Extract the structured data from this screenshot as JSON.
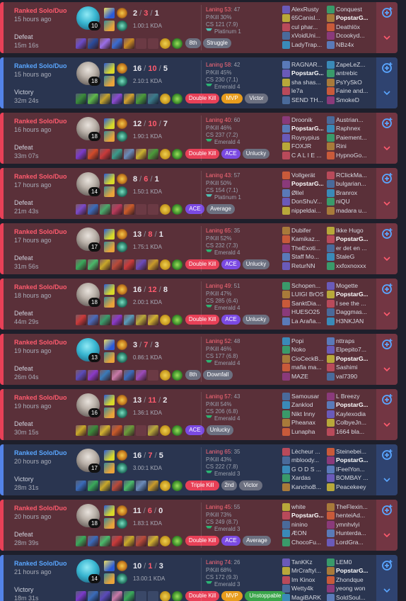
{
  "tags": {
    "double_kill": {
      "label": "Double Kill",
      "color": "#e84057"
    },
    "triple_kill": {
      "label": "Triple Kill",
      "color": "#e84057"
    },
    "mvp": {
      "label": "MVP",
      "color": "#e89d1e"
    },
    "ace": {
      "label": "ACE",
      "color": "#7b4ae2"
    },
    "unstoppable": {
      "label": "Unstoppable",
      "color": "#3aa54a"
    },
    "struggle": {
      "label": "Struggle",
      "color": "#6c7080"
    },
    "victor": {
      "label": "Victor",
      "color": "#6c7080"
    },
    "unlucky": {
      "label": "Unlucky",
      "color": "#6c7080"
    },
    "average": {
      "label": "Average",
      "color": "#6c7080"
    },
    "downfall": {
      "label": "Downfall",
      "color": "#6c7080"
    },
    "place_8th": {
      "label": "8th",
      "color": "#6c7080"
    },
    "place_2nd": {
      "label": "2nd",
      "color": "#6c7080"
    }
  },
  "matches": [
    {
      "result": "Defeat",
      "queue": "Ranked Solo/Duo",
      "ago": "15 hours ago",
      "duration": "15m 16s",
      "champ": "gwen",
      "level": "10",
      "kills": "2",
      "deaths": "3",
      "assists": "1",
      "kda": "1.00:1 KDA",
      "laning_label": "Laning 53",
      "laning_opp": ": 47",
      "pkill": "P/Kill 30%",
      "cs": "CS 121 (7.9)",
      "rank": "Platinum 1",
      "rank_color": "#4ec2b5",
      "items": [
        "#6b4bc8",
        "#2a4a9a",
        "#9a6ee8",
        "#3a6bd0",
        "#c98a24",
        "empty",
        "empty",
        "ward"
      ],
      "tags": [
        "place_8th",
        "struggle"
      ],
      "team1": [
        "AlexRusty",
        "65Canisl...",
        "cul phar...",
        "xVoidUni...",
        "LadyTrap..."
      ],
      "team2": [
        "Conquest",
        "PopstarG...",
        "Deathlöx",
        "Dcookyd...",
        "NBz4x"
      ],
      "me_team": 2,
      "me_idx": 1
    },
    {
      "result": "Victory",
      "queue": "Ranked Solo/Duo",
      "ago": "15 hours ago",
      "duration": "32m 24s",
      "champ": "man",
      "level": "18",
      "kills": "16",
      "deaths": "10",
      "assists": "5",
      "kda": "2.10:1 KDA",
      "laning_label": "Laning 58",
      "laning_opp": ": 42",
      "pkill": "P/Kill 45%",
      "cs": "CS 230 (7.1)",
      "rank": "Emerald 4",
      "rank_color": "#2bb673",
      "items": [
        "#3a8a3a",
        "#5fb84a",
        "#c4a22e",
        "#8a4ad0",
        "#d0a030",
        "#4a9a3a",
        "#3a7a8a",
        "ward"
      ],
      "tags": [
        "double_kill",
        "mvp",
        "victor"
      ],
      "team1": [
        "RAGNAR...",
        "PopstarG...",
        "sha shas...",
        "le7a",
        "SEND TH..."
      ],
      "team2": [
        "ZapeLeZ...",
        "antrebic",
        "PsYySkO",
        "Faine and...",
        "SmokeD"
      ],
      "me_team": 1,
      "me_idx": 1
    },
    {
      "result": "Defeat",
      "queue": "Ranked Solo/Duo",
      "ago": "16 hours ago",
      "duration": "33m 07s",
      "champ": "man",
      "level": "18",
      "kills": "12",
      "deaths": "10",
      "assists": "7",
      "kda": "1.90:1 KDA",
      "laning_label": "Laning 40",
      "laning_opp": ": 60",
      "pkill": "P/Kill 46%",
      "cs": "CS 237 (7.2)",
      "rank": "Emerald 4",
      "rank_color": "#2bb673",
      "items": [
        "#7a3ac8",
        "#d04a2a",
        "#c83a3a",
        "#3a9a8a",
        "#6a8ab8",
        "#c8b030",
        "#4a9a3a",
        "ward"
      ],
      "tags": [
        "double_kill",
        "ace",
        "unlucky"
      ],
      "team1": [
        "Droonik",
        "PopstarG...",
        "Roysypius",
        "FOXJR",
        "C A L I E ..."
      ],
      "team2": [
        "Austrian...",
        "Raphnex",
        "Paiement...",
        "Rini",
        "HypnoGo..."
      ],
      "me_team": 1,
      "me_idx": 1
    },
    {
      "result": "Defeat",
      "queue": "Ranked Solo/Duo",
      "ago": "17 hours ago",
      "duration": "21m 43s",
      "champ": "man",
      "level": "14",
      "kills": "8",
      "deaths": "6",
      "assists": "1",
      "kda": "1.50:1 KDA",
      "laning_label": "Laning 43",
      "laning_opp": ": 57",
      "pkill": "P/Kill 50%",
      "cs": "CS 154 (7.1)",
      "rank": "Platinum 1",
      "rank_color": "#4ec2b5",
      "items": [
        "#7a4ac8",
        "#3a6ab8",
        "#4aa86a",
        "#b83a5a",
        "#c85a2a",
        "empty",
        "empty",
        "ward"
      ],
      "tags": [
        "ace",
        "average"
      ],
      "team1": [
        "Vollgerät",
        "PopstarG...",
        "Øllel",
        "DonShuV...",
        "nippeldai..."
      ],
      "team2": [
        "RClickMa...",
        "bulgarian...",
        "Branrox",
        "niQU",
        "madara u..."
      ],
      "me_team": 1,
      "me_idx": 1
    },
    {
      "result": "Defeat",
      "queue": "Ranked Solo/Duo",
      "ago": "17 hours ago",
      "duration": "31m 56s",
      "champ": "man",
      "level": "17",
      "kills": "13",
      "deaths": "8",
      "assists": "1",
      "kda": "1.75:1 KDA",
      "laning_label": "Laning 65",
      "laning_opp": ": 35",
      "pkill": "P/Kill 52%",
      "cs": "CS 232 (7.3)",
      "rank": "Emerald 4",
      "rank_color": "#2bb673",
      "items": [
        "#3aa85a",
        "#4ab86a",
        "#c8a82a",
        "#b84a3a",
        "#c83a3a",
        "#6a4ab8",
        "#c89a2a",
        "ward"
      ],
      "tags": [
        "double_kill",
        "ace",
        "unlucky"
      ],
      "team1": [
        "Dubifer",
        "Kamikaz...",
        "TheExoti...",
        "Staff Mo...",
        "ReturNN"
      ],
      "team2": [
        "Ikke Hugo",
        "PopstarG...",
        "er det en ...",
        "StaleG",
        "xxfoxnoxxx"
      ],
      "me_team": 2,
      "me_idx": 1
    },
    {
      "result": "Defeat",
      "queue": "Ranked Solo/Duo",
      "ago": "18 hours ago",
      "duration": "44m 29s",
      "champ": "man",
      "level": "18",
      "kills": "16",
      "deaths": "12",
      "assists": "8",
      "kda": "2.00:1 KDA",
      "laning_label": "Laning 49",
      "laning_opp": ": 51",
      "pkill": "P/Kill 47%",
      "cs": "CS 285 (6.4)",
      "rank": "Emerald 4",
      "rank_color": "#2bb673",
      "items": [
        "#c83a3a",
        "#4a6ab8",
        "#3a9a6a",
        "#8a3ac8",
        "#5a9ab8",
        "#b8a83a",
        "#d0b030",
        "ward"
      ],
      "tags": [
        "double_kill",
        "ace",
        "unlucky"
      ],
      "team1": [
        "Schopen...",
        "LUIGI BrOS",
        "SanktDia...",
        "HUESO25",
        "La Araña..."
      ],
      "team2": [
        "Mogette",
        "PopstarG...",
        "I see the ...",
        "Daggmas...",
        "H3NKJAN"
      ],
      "me_team": 2,
      "me_idx": 1
    },
    {
      "result": "Defeat",
      "queue": "Ranked Solo/Duo",
      "ago": "19 hours ago",
      "duration": "26m 04s",
      "champ": "gwen",
      "level": "13",
      "kills": "3",
      "deaths": "7",
      "assists": "3",
      "kda": "0.86:1 KDA",
      "laning_label": "Laning 52",
      "laning_opp": ": 48",
      "pkill": "P/Kill 46%",
      "cs": "CS 177 (6.8)",
      "rank": "Emerald 4",
      "rank_color": "#2bb673",
      "items": [
        "#5a4ab8",
        "#8a3ac8",
        "#3a7ab8",
        "#c87aa8",
        "#3a6ab8",
        "#9a4ab8",
        "empty",
        "ward"
      ],
      "tags": [
        "place_8th",
        "downfall"
      ],
      "team1": [
        "Popi",
        "Noko",
        "CioCeckB...",
        "mafia ma...",
        "MAZE"
      ],
      "team2": [
        "nttraps",
        "Elpepito7...",
        "PopstarG...",
        "Sashimi",
        "val7390"
      ],
      "me_team": 2,
      "me_idx": 2
    },
    {
      "result": "Defeat",
      "queue": "Ranked Solo/Duo",
      "ago": "19 hours ago",
      "duration": "30m 15s",
      "champ": "man",
      "level": "16",
      "kills": "13",
      "deaths": "11",
      "assists": "2",
      "kda": "1.36:1 KDA",
      "laning_label": "Laning 57",
      "laning_opp": ": 43",
      "pkill": "P/Kill 54%",
      "cs": "CS 206 (6.8)",
      "rank": "Emerald 4",
      "rank_color": "#2bb673",
      "items": [
        "#c8a82a",
        "#3a8a3a",
        "#d0b030",
        "#c85a2a",
        "#6a9a3a",
        "empty",
        "#b8a83a",
        "ward"
      ],
      "tags": [
        "ace",
        "unlucky"
      ],
      "team1": [
        "Samousar",
        "Zanklod",
        "Nikt Inny",
        "Pheanax",
        "Lunapha"
      ],
      "team2": [
        "L Breezy",
        "PopstarG...",
        "Kaylexodia",
        "ColbyeJn...",
        "1664 bla..."
      ],
      "me_team": 2,
      "me_idx": 1
    },
    {
      "result": "Victory",
      "queue": "Ranked Solo/Duo",
      "ago": "20 hours ago",
      "duration": "28m 31s",
      "champ": "man",
      "level": "17",
      "kills": "16",
      "deaths": "7",
      "assists": "5",
      "kda": "3.00:1 KDA",
      "laning_label": "Laning 65",
      "laning_opp": ": 35",
      "pkill": "P/Kill 43%",
      "cs": "CS 222 (7.8)",
      "rank": "Emerald 3",
      "rank_color": "#2bb673",
      "items": [
        "#3a6ab8",
        "#3aa85a",
        "#c8a82a",
        "#b84a3a",
        "#4ab86a",
        "#6a8ab8",
        "#c89a2a",
        "ward"
      ],
      "tags": [
        "triple_kill",
        "place_2nd",
        "victor"
      ],
      "team1": [
        "Lècheur ...",
        "mbloody...",
        "G O D S ...",
        "Xardas",
        "KanchoB..."
      ],
      "team2": [
        "Steinebei...",
        "PopstarG...",
        "IFeelYon...",
        "BOMBAY ...",
        "Peacekeey"
      ],
      "me_team": 2,
      "me_idx": 1
    },
    {
      "result": "Defeat",
      "queue": "Ranked Solo/Duo",
      "ago": "20 hours ago",
      "duration": "28m 39s",
      "champ": "man",
      "level": "18",
      "kills": "11",
      "deaths": "6",
      "assists": "0",
      "kda": "1.83:1 KDA",
      "laning_label": "Laning 45",
      "laning_opp": ": 55",
      "pkill": "P/Kill 73%",
      "cs": "CS 249 (8.7)",
      "rank": "Emerald 3",
      "rank_color": "#2bb673",
      "items": [
        "#3aa85a",
        "#3a6ab8",
        "#4ab86a",
        "#c83a3a",
        "#c8a82a",
        "#b84a3a",
        "#d0b030",
        "ward"
      ],
      "tags": [
        "double_kill",
        "ace",
        "average"
      ],
      "team1": [
        "white",
        "PopstarG...",
        "ninino",
        "ÆON",
        "ChocoFu..."
      ],
      "team2": [
        "TheFlexin...",
        "henteiAd...",
        "ymnhvlyi",
        "Hunterda...",
        "LordGra..."
      ],
      "me_team": 1,
      "me_idx": 1
    },
    {
      "result": "Victory",
      "queue": "Ranked Solo/Duo",
      "ago": "21 hours ago",
      "duration": "18m 31s",
      "champ": "gwen",
      "level": "14",
      "kills": "10",
      "deaths": "1",
      "assists": "3",
      "kda": "13.00:1 KDA",
      "laning_label": "Laning 74",
      "laning_opp": ": 26",
      "pkill": "P/Kill 68%",
      "cs": "CS 172 (9.3)",
      "rank": "Emerald 3",
      "rank_color": "#2bb673",
      "items": [
        "#7a3ac8",
        "#3a6ab8",
        "#5a4ab8",
        "#c87aa8",
        "#3aa85a",
        "empty",
        "empty",
        "ward"
      ],
      "tags": [
        "double_kill",
        "mvp",
        "unstoppable"
      ],
      "team1": [
        "TanKKz",
        "MrCraftyl...",
        "Im Kinox",
        "Wetty4k",
        "MagiBARK"
      ],
      "team2": [
        "LEM0",
        "PopstarG...",
        "Zhondque",
        "yeong won",
        "SoldSoul..."
      ],
      "me_team": 2,
      "me_idx": 1
    }
  ]
}
